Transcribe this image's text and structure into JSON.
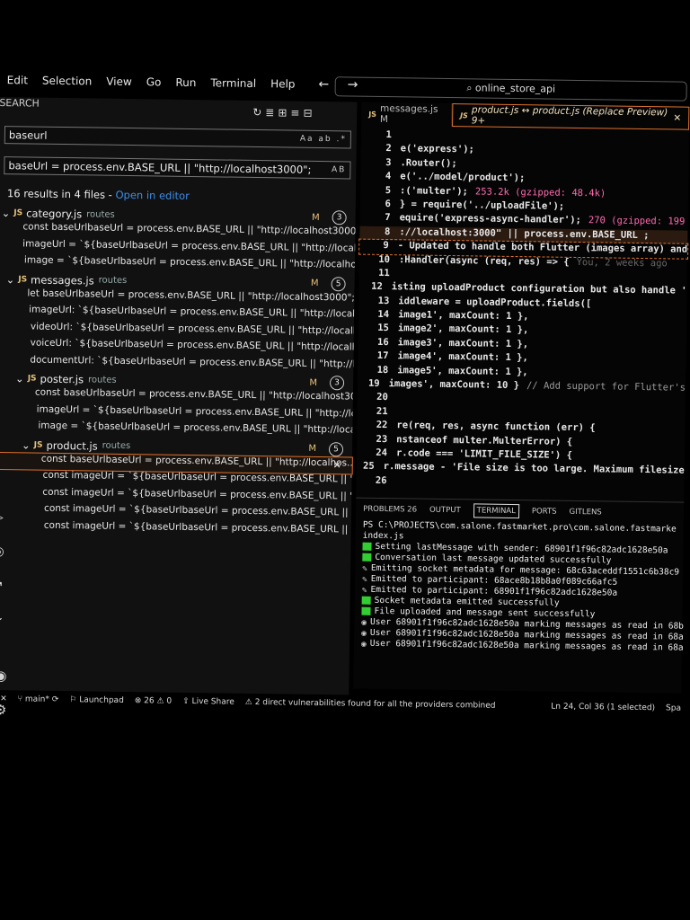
{
  "menubar": {
    "items": [
      "Edit",
      "Selection",
      "View",
      "Go",
      "Run",
      "Terminal",
      "Help"
    ],
    "nav": "← →",
    "search": "⌕ online_store_api"
  },
  "sidebar": {
    "title": "SEARCH",
    "search_value": "baseurl",
    "search_opts": "Aa ab .*",
    "replace_value": "baseUrl = process.env.BASE_URL || \"http://localhost3000\";",
    "replace_opts": "AB",
    "results_summary": "16 results in 4 files - ",
    "open_in_editor": "Open in editor",
    "files": [
      {
        "name": "category.js",
        "path": "routes",
        "status": "M",
        "count": "3",
        "matches": [
          "const baseUrlbaseUrl = process.env.BASE_URL || \"http://localhost3000\"; = ...",
          "imageUrl = `${baseUrlbaseUrl = process.env.BASE_URL || \"http://localhost3...",
          "image = `${baseUrlbaseUrl = process.env.BASE_URL || \"http://localhost300..."
        ]
      },
      {
        "name": "messages.js",
        "path": "routes",
        "status": "M",
        "count": "5",
        "matches": [
          "let baseUrlbaseUrl = process.env.BASE_URL || \"http://localhost3000\"; = \"htt...",
          "imageUrl: `${baseUrlbaseUrl = process.env.BASE_URL || \"http://localhost30...",
          "videoUrl: `${baseUrlbaseUrl = process.env.BASE_URL || \"http://localhost30...",
          "voiceUrl: `${baseUrlbaseUrl = process.env.BASE_URL || \"http://localhost300...",
          "documentUrl: `${baseUrlbaseUrl = process.env.BASE_URL || \"http://localhos..."
        ]
      },
      {
        "name": "poster.js",
        "path": "routes",
        "status": "M",
        "count": "3",
        "matches": [
          "const baseUrlbaseUrl = process.env.BASE_URL || \"http://localhost3000\"; = ...",
          "imageUrl = `${baseUrlbaseUrl = process.env.BASE_URL || \"http://localhost3...",
          "image = `${baseUrlbaseUrl = process.env.BASE_URL || \"http://localhost300..."
        ]
      },
      {
        "name": "product.js",
        "path": "routes",
        "status": "M",
        "count": "5",
        "matches": [
          "const baseUrlbaseUrl = process.env.BASE_URL || \"http://localhos...",
          "const imageUrl = `${baseUrlbaseUrl = process.env.BASE_URL || \"http://local...",
          "const imageUrl = `${baseUrlbaseUrl = process.env.BASE_URL || \"http://local...",
          "const imageUrl = `${baseUrlbaseUrl = process.env.BASE_URL || \"http://local...",
          "const imageUrl = `${baseUrlbaseUrl = process.env.BASE_URL || \"http://local..."
        ]
      }
    ]
  },
  "editor": {
    "tabs": [
      {
        "label": "messages.js M",
        "active": false
      },
      {
        "label": "product.js ↔ product.js (Replace Preview) 9+",
        "active": true
      }
    ],
    "lines": [
      {
        "n": "1",
        "text": ""
      },
      {
        "n": "2",
        "text": "e('express');"
      },
      {
        "n": "3",
        "text": ".Router();"
      },
      {
        "n": "4",
        "text": "e('../model/product');"
      },
      {
        "n": "5",
        "text": ":('multer');",
        "extra": "253.2k (gzipped: 48.4k)"
      },
      {
        "n": "6",
        "text": "} = require('../uploadFile');"
      },
      {
        "n": "7",
        "text": "equire('express-async-handler');",
        "extra": "270 (gzipped: 199"
      },
      {
        "n": "8",
        "text": "://localhost:3000\" || process.env.BASE_URL ;"
      },
      {
        "n": "9",
        "text": "- Updated to handle both Flutter (images array) and"
      },
      {
        "n": "10",
        "text": ":Handler(async (req, res) => {",
        "extra": "You, 2 weeks ago"
      },
      {
        "n": "11",
        "text": ""
      },
      {
        "n": "12",
        "text": "isting uploadProduct configuration but also handle '"
      },
      {
        "n": "13",
        "text": "iddleware = uploadProduct.fields(["
      },
      {
        "n": "14",
        "text": "image1', maxCount: 1 },"
      },
      {
        "n": "15",
        "text": "image2', maxCount: 1 },"
      },
      {
        "n": "16",
        "text": "image3', maxCount: 1 },"
      },
      {
        "n": "17",
        "text": "image4', maxCount: 1 },"
      },
      {
        "n": "18",
        "text": "image5', maxCount: 1 },"
      },
      {
        "n": "19",
        "text": "images', maxCount: 10 }",
        "extra": "// Add support for Flutter's"
      },
      {
        "n": "20",
        "text": ""
      },
      {
        "n": "21",
        "text": ""
      },
      {
        "n": "22",
        "text": "re(req, res, async function (err) {"
      },
      {
        "n": "23",
        "text": "nstanceof multer.MulterError) {"
      },
      {
        "n": "24",
        "text": "r.code === 'LIMIT_FILE_SIZE') {"
      },
      {
        "n": "25",
        "text": "r.message - 'File size is too large. Maximum filesize"
      },
      {
        "n": "26",
        "text": ""
      }
    ]
  },
  "panel": {
    "tabs": [
      "PROBLEMS 26",
      "OUTPUT",
      "TERMINAL",
      "PORTS",
      "GITLENS"
    ],
    "active_tab": "TERMINAL",
    "prompt": "PS C:\\PROJECTS\\com.salone.fastmarket.pro\\com.salone.fastmarke",
    "prompt2": "index.js",
    "logs": [
      {
        "icon": "green",
        "text": "Setting lastMessage with sender: 68901f1f96c82adc1628e50a"
      },
      {
        "icon": "green",
        "text": "Conversation last message updated successfully"
      },
      {
        "icon": "pen",
        "text": "Emitting socket metadata for message: 68c63aceddf1551c6b38c9"
      },
      {
        "icon": "pen",
        "text": "Emitted to participant: 68ace8b18b8a0f089c66afc5"
      },
      {
        "icon": "pen",
        "text": "Emitted to participant: 68901f1f96c82adc1628e50a"
      },
      {
        "icon": "green",
        "text": "Socket metadata emitted successfully"
      },
      {
        "icon": "green",
        "text": "File uploaded and message sent successfully"
      },
      {
        "icon": "eye",
        "text": "User 68901f1f96c82adc1628e50a marking messages as read in 68b"
      },
      {
        "icon": "eye",
        "text": "User 68901f1f96c82adc1628e50a marking messages as read in 68a"
      },
      {
        "icon": "eye",
        "text": "User 68901f1f96c82adc1628e50a marking messages as read in 68a"
      }
    ]
  },
  "status": {
    "branch": "main*",
    "launchpad": "Launchpad",
    "problems": "⊗ 26 ⚠ 0",
    "liveshare": "Live Share",
    "vulns": "⚠ 2 direct vulnerabilities found for all the providers combined",
    "cursor": "Ln 24, Col 36 (1 selected)",
    "spaces": "Spa"
  }
}
